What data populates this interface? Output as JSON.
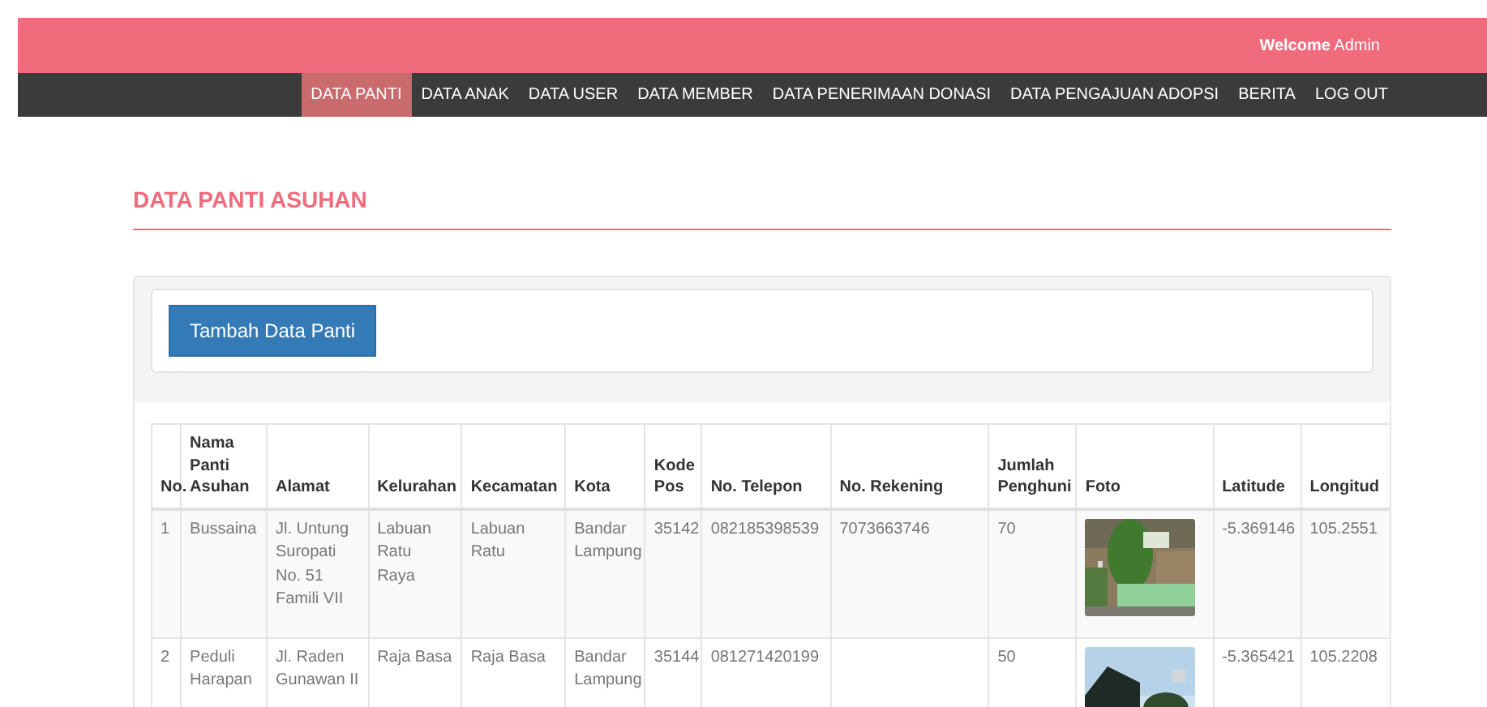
{
  "header": {
    "welcome": "**Welcome** Admin"
  },
  "nav": [
    {
      "label": "DATA PANTI",
      "selected": true
    },
    {
      "label": "DATA ANAK",
      "selected": false
    },
    {
      "label": "DATA USER",
      "selected": false
    },
    {
      "label": "DATA MEMBER",
      "selected": false
    },
    {
      "label": "DATA PENERIMAAN DONASI",
      "selected": false
    },
    {
      "label": "DATA PENGAJUAN ADOPSI",
      "selected": false
    },
    {
      "label": "BERITA",
      "selected": false
    },
    {
      "label": "LOG OUT",
      "selected": false
    }
  ],
  "page_title": "DATA PANTI ASUHAN",
  "add_button": "Tambah Data Panti",
  "table": {
    "columns": [
      "No.",
      "Nama Panti Asuhan",
      "Alamat",
      "Kelurahan",
      "Kecamatan",
      "Kota",
      "Kode Pos",
      "No. Telepon",
      "No. Rekening",
      "Jumlah Penghuni",
      "Foto",
      "Latitude",
      "Longitud"
    ],
    "rows": [
      {
        "cells": [
          "1",
          "Bussaina",
          "Jl. Untung Suropati No. 51 Famili VII",
          "Labuan Ratu Raya",
          "Labuan Ratu",
          "Bandar Lampung",
          "35142",
          "082185398539",
          "7073663746",
          "70",
          {
            "kind": "picture"
          },
          "-5.369146",
          "105.2551"
        ]
      },
      {
        "cells": [
          "2",
          "Peduli Harapan",
          "Jl. Raden Gunawan II",
          "Raja Basa",
          "Raja Basa",
          "Bandar Lampung",
          "35144",
          "081271420199",
          null,
          "50",
          {
            "kind": "picture"
          },
          "-5.365421",
          "105.2208"
        ]
      }
    ]
  }
}
